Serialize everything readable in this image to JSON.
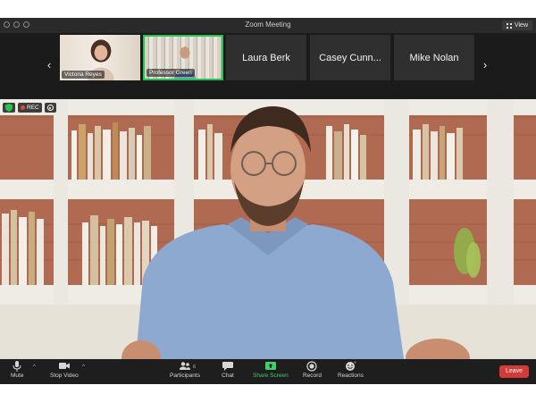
{
  "window": {
    "title": "Zoom Meeting",
    "view_label": "View"
  },
  "participants": [
    {
      "name": "Victoria Reyes",
      "has_video": true
    },
    {
      "name": "Professor Green",
      "has_video": true,
      "active_speaker": true
    },
    {
      "name": "Laura Berk",
      "has_video": false
    },
    {
      "name": "Casey Cunn...",
      "has_video": false
    },
    {
      "name": "Mike Nolan",
      "has_video": false
    }
  ],
  "status": {
    "rec_label": "REC"
  },
  "toolbar": {
    "mute": "Mute",
    "stop_video": "Stop Video",
    "participants": "Participants",
    "participants_count": "6",
    "chat": "Chat",
    "share_screen": "Share Screen",
    "record": "Record",
    "reactions": "Reactions",
    "leave": "Leave"
  },
  "colors": {
    "active_speaker_border": "#23c552",
    "share_screen": "#3fd16a",
    "leave_button": "#d53b36",
    "rec_dot": "#e24646"
  }
}
